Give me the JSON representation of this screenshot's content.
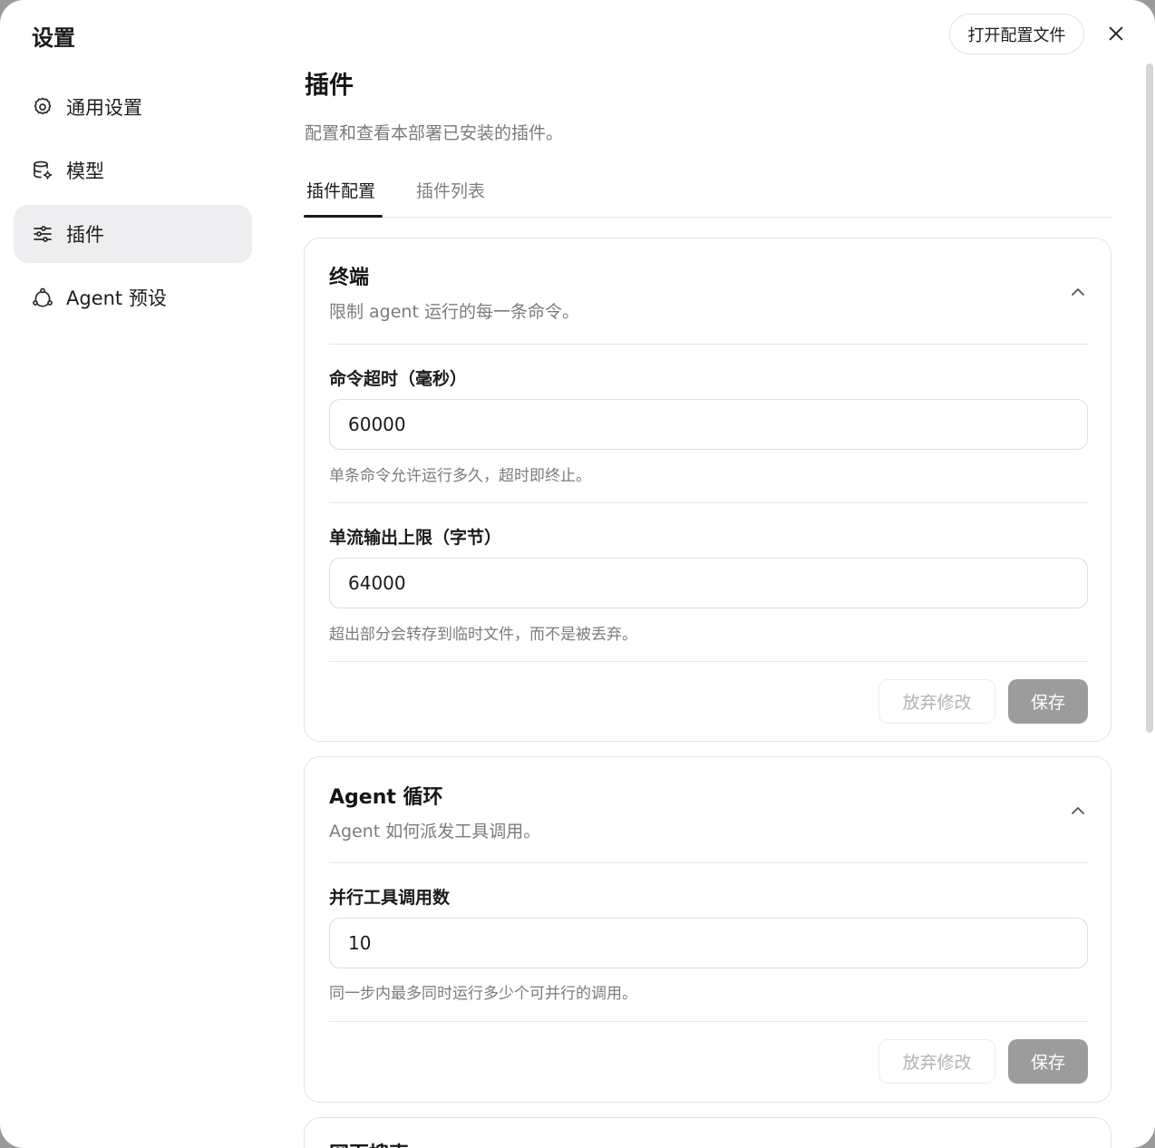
{
  "app": {
    "title": "设置"
  },
  "sidebar": {
    "items": [
      {
        "label": "通用设置",
        "icon": "gear-icon"
      },
      {
        "label": "模型",
        "icon": "database-gear-icon"
      },
      {
        "label": "插件",
        "icon": "sliders-icon",
        "active": true
      },
      {
        "label": "Agent 预设",
        "icon": "network-icon"
      }
    ]
  },
  "header": {
    "open_config_label": "打开配置文件",
    "close_icon": "close-icon"
  },
  "main": {
    "title": "插件",
    "description": "配置和查看本部署已安装的插件。",
    "tabs": [
      {
        "label": "插件配置",
        "active": true
      },
      {
        "label": "插件列表",
        "active": false
      }
    ]
  },
  "cards": [
    {
      "title": "终端",
      "subtitle": "限制 agent 运行的每一条命令。",
      "fields": [
        {
          "label": "命令超时（毫秒）",
          "value": "60000",
          "help": "单条命令允许运行多久，超时即终止。"
        },
        {
          "label": "单流输出上限（字节）",
          "value": "64000",
          "help": "超出部分会转存到临时文件，而不是被丢弃。"
        }
      ],
      "discard_label": "放弃修改",
      "save_label": "保存"
    },
    {
      "title": "Agent 循环",
      "subtitle": "Agent 如何派发工具调用。",
      "fields": [
        {
          "label": "并行工具调用数",
          "value": "10",
          "help": "同一步内最多同时运行多少个可并行的调用。"
        }
      ],
      "discard_label": "放弃修改",
      "save_label": "保存"
    },
    {
      "title": "网页搜索"
    }
  ],
  "colors": {
    "accent": "#1a1a1a",
    "active_bg": "#eeeef0",
    "save_disabled": "#9c9c9c"
  }
}
